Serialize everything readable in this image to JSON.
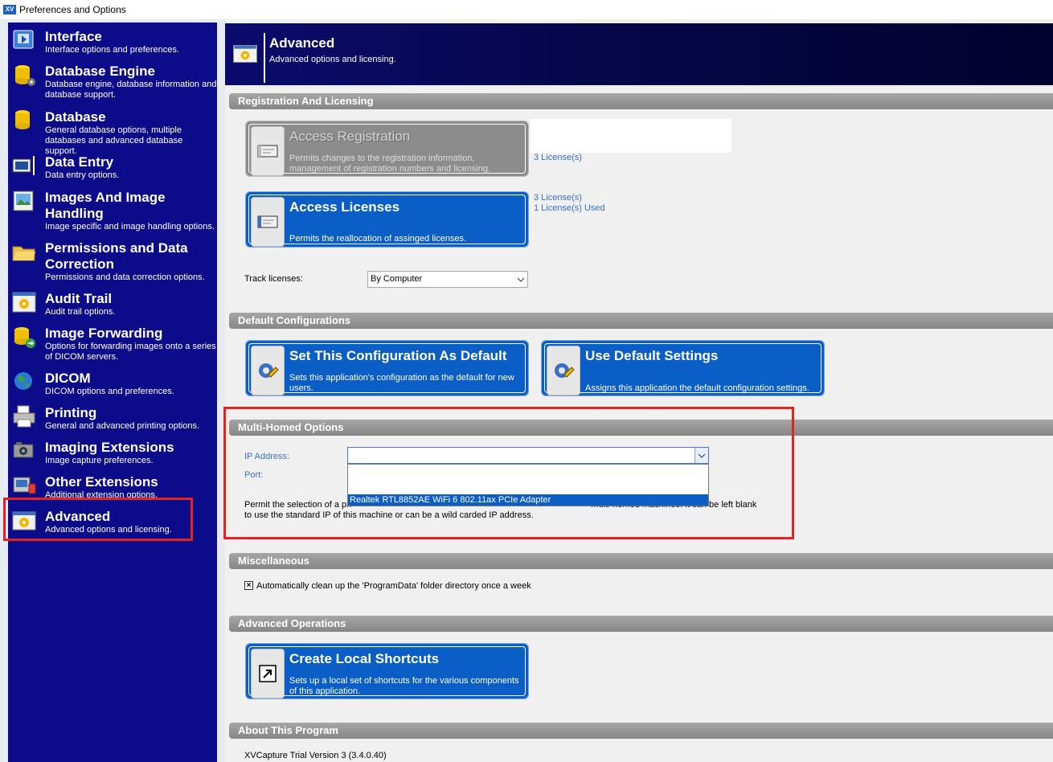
{
  "window": {
    "title": "Preferences and Options",
    "icon_text": "XV"
  },
  "sidebar": {
    "items": [
      {
        "title": "Interface",
        "desc": "Interface options and preferences.",
        "icon": "interface-icon"
      },
      {
        "title": "Database Engine",
        "desc": "Database engine, database information and database support.",
        "icon": "database-engine-icon"
      },
      {
        "title": "Database",
        "desc": "General database options, multiple databases and advanced database support.",
        "icon": "database-icon"
      },
      {
        "title": "Data Entry",
        "desc": "Data entry options.",
        "icon": "data-entry-icon"
      },
      {
        "title": "Images And Image Handling",
        "desc": "Image specific and image handling options.",
        "icon": "image-icon"
      },
      {
        "title": "Permissions and Data Correction",
        "desc": "Permissions and data correction options.",
        "icon": "folder-icon"
      },
      {
        "title": "Audit Trail",
        "desc": "Audit trail options.",
        "icon": "audit-trail-icon"
      },
      {
        "title": "Image Forwarding",
        "desc": "Options for forwarding images onto a series of DICOM servers.",
        "icon": "image-forwarding-icon"
      },
      {
        "title": "DICOM",
        "desc": "DICOM options and preferences.",
        "icon": "globe-icon"
      },
      {
        "title": "Printing",
        "desc": "General and advanced printing options.",
        "icon": "printer-icon"
      },
      {
        "title": "Imaging Extensions",
        "desc": "Image capture preferences.",
        "icon": "camera-icon"
      },
      {
        "title": "Other Extensions",
        "desc": "Additional extension options.",
        "icon": "extensions-icon"
      },
      {
        "title": "Advanced",
        "desc": "Advanced options and licensing.",
        "icon": "advanced-icon"
      }
    ],
    "selected_index": 12
  },
  "header": {
    "title": "Advanced",
    "subtitle": "Advanced options and licensing."
  },
  "registration": {
    "section_title": "Registration And Licensing",
    "access_registration": {
      "title": "Access Registration",
      "desc": "Permits changes to the registration information, management of registration numbers and licensing."
    },
    "reg_license_count": "3 License(s)",
    "access_licenses": {
      "title": "Access Licenses",
      "desc": "Permits the reallocation of assinged licenses."
    },
    "licenses_count": "3 License(s)",
    "licenses_used": "1 License(s) Used",
    "track_label": "Track licenses:",
    "track_value": "By Computer"
  },
  "default_config": {
    "section_title": "Default Configurations",
    "set_default": {
      "title": "Set This Configuration As Default",
      "desc": "Sets this application's configuration as the default for new users."
    },
    "use_default": {
      "title": "Use Default Settings",
      "desc": "Assigns this application the default configuration settings."
    }
  },
  "multi_homed": {
    "section_title": "Multi-Homed Options",
    "ip_label": "IP Address:",
    "port_label": "Port:",
    "ip_value": "",
    "dropdown_option": "Realtek RTL8852AE WiFi 6 802.11ax PCIe Adapter",
    "desc_line1_start": "Permit the selection of a pri",
    "desc_line1_end": "multi-homed machines. It can be left blank",
    "desc_line2": "to use the standard IP of this machine or can be a wild carded IP address."
  },
  "misc": {
    "section_title": "Miscellaneous",
    "cleanup_label": "Automatically clean up the 'ProgramData' folder directory once a week",
    "cleanup_checked": true
  },
  "advanced_ops": {
    "section_title": "Advanced Operations",
    "shortcuts": {
      "title": "Create Local Shortcuts",
      "desc": "Sets up a local set of shortcuts for the various components of this application."
    }
  },
  "about": {
    "section_title": "About This Program",
    "version": "XVCapture Trial Version 3 (3.4.0.40)"
  },
  "colors": {
    "sidebar_bg": "#0c0c8a",
    "button_blue": "#0a5ec5",
    "highlight_red": "#e22323",
    "section_gray": "#969696",
    "link_blue": "#3a6fc2"
  }
}
